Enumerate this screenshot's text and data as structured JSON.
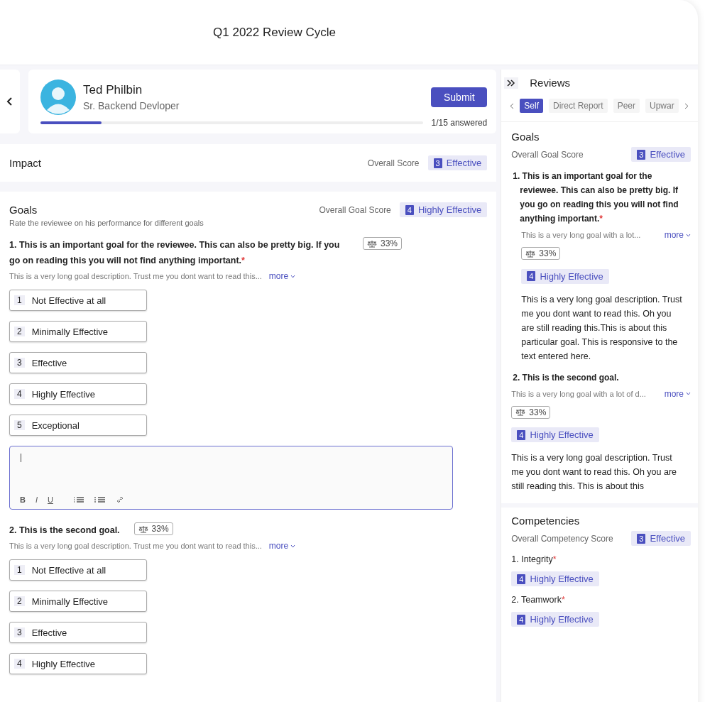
{
  "header": {
    "title": "Q1 2022 Review Cycle"
  },
  "reviewee": {
    "name": "Ted Philbin",
    "role": "Sr. Backend Devloper",
    "submit": "Submit",
    "progress": {
      "level": 0.16,
      "text": "1/15 answered"
    }
  },
  "impact": {
    "title": "Impact",
    "score_label": "Overall Score",
    "score": {
      "number": "3",
      "label": "Effective"
    }
  },
  "goals": {
    "title": "Goals",
    "subtitle": "Rate the reviewee on his performance for different goals",
    "score_label": "Overall Goal Score",
    "score": {
      "number": "4",
      "label": "Highly Effective"
    },
    "items": [
      {
        "title": "1. This is an important goal for the reviewee. This can also be pretty big. If you go on reading this you will not find anything important.",
        "mark": "*",
        "weight": "33%",
        "description": "This is a very long goal description. Trust me you dont want to read this...",
        "more": "more",
        "options": [
          {
            "number": "1",
            "label": "Not Effective at all",
            "selected": false
          },
          {
            "number": "2",
            "label": "Minimally Effective",
            "selected": false
          },
          {
            "number": "3",
            "label": "Effective",
            "selected": false
          },
          {
            "number": "4",
            "label": "Highly Effective",
            "selected": false
          },
          {
            "number": "5",
            "label": "Exceptional",
            "selected": false
          }
        ],
        "editor": {
          "toolbar": [
            "B",
            "I",
            "U"
          ]
        }
      },
      {
        "title": "2. This is the second goal.",
        "weight": "33%",
        "description": "This is a very long goal description. Trust me you dont want to read this...",
        "more": "more",
        "options": [
          {
            "number": "1",
            "label": "Not Effective at all",
            "selected": false
          },
          {
            "number": "2",
            "label": "Minimally Effective",
            "selected": false
          },
          {
            "number": "3",
            "label": "Effective",
            "selected": false
          },
          {
            "number": "4",
            "label": "Highly Effective",
            "selected": false
          }
        ]
      }
    ]
  },
  "reviews": {
    "title": "Reviews",
    "tabs": [
      {
        "label": "Self",
        "selected": true
      },
      {
        "label": "Direct Report",
        "selected": false
      },
      {
        "label": "Peer",
        "selected": false
      },
      {
        "label": "Upwar",
        "selected": false
      }
    ],
    "goals": {
      "title": "Goals",
      "score_label": "Overall Goal Score",
      "score": {
        "number": "3",
        "label": "Effective"
      },
      "items": [
        {
          "title": "1. This is an important goal for the reviewee. This can also be pretty big. If you go on reading this you will not find anything important.",
          "mark": "*",
          "description": "This is a very long goal with a lot...",
          "more": "more",
          "weight": "33%",
          "rating": {
            "number": "4",
            "label": "Highly Effective"
          },
          "comment": "This is a very long goal description. Trust me you dont want to read this. Oh you are still reading this.This is about this particular goal.  This is responsive to the text entered here."
        },
        {
          "title": "2. This is the second goal.",
          "description": "This is a very long goal with a lot of d...",
          "more": "more",
          "weight": "33%",
          "rating": {
            "number": "4",
            "label": "Highly Effective"
          },
          "comment": "This is a very long goal description. Trust me you dont want to read this. Oh you are still reading this. This is about this"
        }
      ]
    },
    "competencies": {
      "title": "Competencies",
      "score_label": "Overall Competency Score",
      "score": {
        "number": "3",
        "label": "Effective"
      },
      "items": [
        {
          "title": "1. Integrity",
          "mark": "*",
          "rating": {
            "number": "4",
            "label": "Highly Effective"
          }
        },
        {
          "title": "2. Teamwork",
          "mark": "*",
          "rating": {
            "number": "4",
            "label": "Highly Effective"
          }
        }
      ]
    }
  }
}
